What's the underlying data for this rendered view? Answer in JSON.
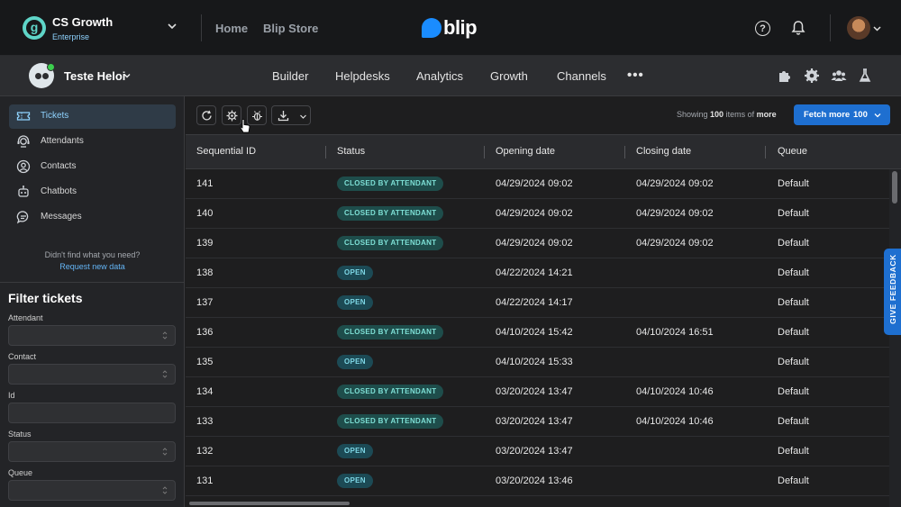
{
  "org": {
    "initial": "g",
    "name": "CS Growth",
    "plan": "Enterprise"
  },
  "topnav": {
    "home": "Home",
    "store": "Blip Store"
  },
  "brand": {
    "name": "blip"
  },
  "help": {
    "glyph": "?"
  },
  "bot": {
    "name": "Teste Heloi"
  },
  "menu": {
    "builder": "Builder",
    "helpdesks": "Helpdesks",
    "analytics": "Analytics",
    "growth": "Growth",
    "channels": "Channels",
    "more": "•••"
  },
  "sidebar": {
    "items": [
      {
        "label": "Tickets",
        "icon": "ticket-icon"
      },
      {
        "label": "Attendants",
        "icon": "headset-icon"
      },
      {
        "label": "Contacts",
        "icon": "user-circle-icon"
      },
      {
        "label": "Chatbots",
        "icon": "robot-icon"
      },
      {
        "label": "Messages",
        "icon": "chat-icon"
      }
    ],
    "help_text": "Didn't find what you need?",
    "help_link": "Request new data"
  },
  "filters": {
    "title": "Filter tickets",
    "attendant": "Attendant",
    "contact": "Contact",
    "id": "Id",
    "status": "Status",
    "queue": "Queue"
  },
  "toolbar": {
    "showing_prefix": "Showing",
    "showing_count": "100",
    "showing_mid": "items of",
    "showing_suffix": "more",
    "fetch_label": "Fetch more",
    "fetch_count": "100"
  },
  "table": {
    "headers": {
      "id": "Sequential ID",
      "status": "Status",
      "opening": "Opening date",
      "closing": "Closing date",
      "queue": "Queue"
    },
    "rows": [
      {
        "id": "141",
        "status": "CLOSED BY ATTENDANT",
        "opening": "04/29/2024 09:02",
        "closing": "04/29/2024 09:02",
        "queue": "Default"
      },
      {
        "id": "140",
        "status": "CLOSED BY ATTENDANT",
        "opening": "04/29/2024 09:02",
        "closing": "04/29/2024 09:02",
        "queue": "Default"
      },
      {
        "id": "139",
        "status": "CLOSED BY ATTENDANT",
        "opening": "04/29/2024 09:02",
        "closing": "04/29/2024 09:02",
        "queue": "Default"
      },
      {
        "id": "138",
        "status": "OPEN",
        "opening": "04/22/2024 14:21",
        "closing": "",
        "queue": "Default"
      },
      {
        "id": "137",
        "status": "OPEN",
        "opening": "04/22/2024 14:17",
        "closing": "",
        "queue": "Default"
      },
      {
        "id": "136",
        "status": "CLOSED BY ATTENDANT",
        "opening": "04/10/2024 15:42",
        "closing": "04/10/2024 16:51",
        "queue": "Default"
      },
      {
        "id": "135",
        "status": "OPEN",
        "opening": "04/10/2024 15:33",
        "closing": "",
        "queue": "Default"
      },
      {
        "id": "134",
        "status": "CLOSED BY ATTENDANT",
        "opening": "03/20/2024 13:47",
        "closing": "04/10/2024 10:46",
        "queue": "Default"
      },
      {
        "id": "133",
        "status": "CLOSED BY ATTENDANT",
        "opening": "03/20/2024 13:47",
        "closing": "04/10/2024 10:46",
        "queue": "Default"
      },
      {
        "id": "132",
        "status": "OPEN",
        "opening": "03/20/2024 13:47",
        "closing": "",
        "queue": "Default"
      },
      {
        "id": "131",
        "status": "OPEN",
        "opening": "03/20/2024 13:46",
        "closing": "",
        "queue": "Default"
      }
    ]
  },
  "feedback": {
    "label": "GIVE FEEDBACK"
  },
  "colors": {
    "accent": "#1e6fd0",
    "badge_bg": "#1e4d4b",
    "badge_text": "#7ee0d6"
  }
}
